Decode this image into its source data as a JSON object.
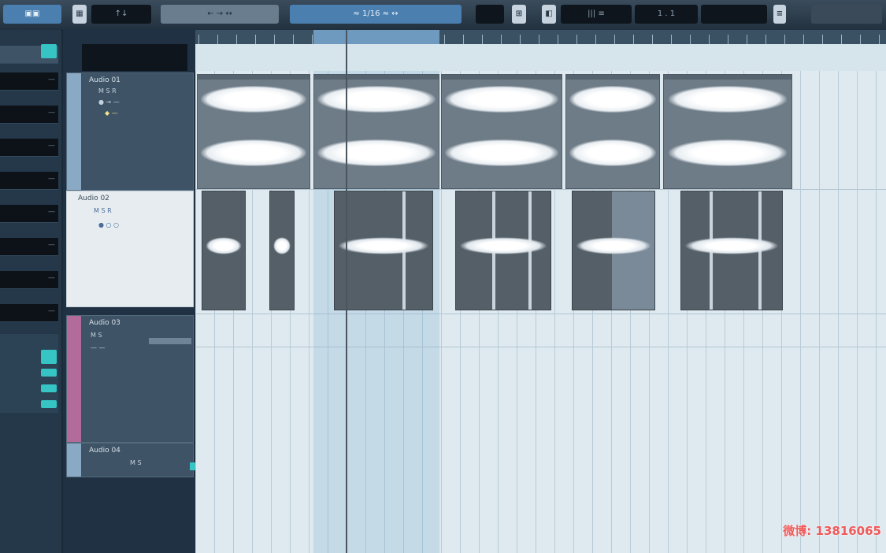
{
  "toolbar": {
    "mode_button": "▣▣",
    "count_field": "↑↓",
    "snap_label": "← → ↔",
    "quantize_label": "≈ 1/16 ≈ ↔",
    "zoom_icon": "⊞",
    "time_field": "|||  ≡",
    "meter_field": "1 . 1"
  },
  "inspector": {
    "rows": [
      "—",
      "—",
      "—",
      "—",
      "—",
      "—",
      "—",
      "—"
    ]
  },
  "tracks": [
    {
      "name": "Audio 01",
      "lines": [
        "M S R",
        "● → —",
        "◆ —"
      ]
    },
    {
      "name": "Audio 02",
      "lines": [
        "M S R",
        "● ○ ○"
      ]
    },
    {
      "name": "Audio 03",
      "lines": [
        "M S",
        "— —"
      ]
    },
    {
      "name": "Audio 04",
      "lines": [
        "M S"
      ]
    }
  ],
  "watermark": {
    "label": "微博",
    "handle": ": 13816065"
  },
  "colors": {
    "accent": "#36c4c4",
    "lane_bg": "#dfeaf0",
    "clip": "#6e7c88"
  },
  "icons": [
    "grid-icon",
    "zoom-icon",
    "playhead-cursor"
  ]
}
